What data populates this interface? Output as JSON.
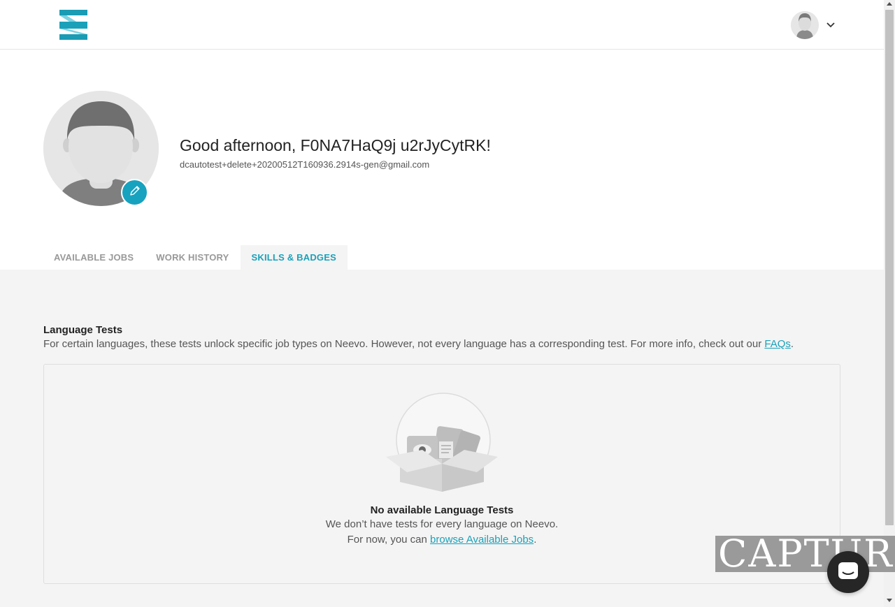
{
  "header": {
    "logo_name": "neevo-logo",
    "account_menu_icon": "chevron-down-icon"
  },
  "profile": {
    "greeting": "Good afternoon, F0NA7HaQ9j u2rJyCytRK!",
    "email": "dcautotest+delete+20200512T160936.2914s-gen@gmail.com",
    "edit_icon": "pencil-icon"
  },
  "tabs": [
    {
      "label": "AVAILABLE JOBS",
      "active": false
    },
    {
      "label": "WORK HISTORY",
      "active": false
    },
    {
      "label": "SKILLS & BADGES",
      "active": true
    }
  ],
  "language_tests": {
    "title": "Language Tests",
    "description_prefix": "For certain languages, these tests unlock specific job types on Neevo. However, not every language has a corresponding test. For more info, check out our ",
    "faq_link": "FAQs",
    "description_suffix": ".",
    "empty_title": "No available Language Tests",
    "empty_line1": "We don’t have tests for every language on Neevo.",
    "empty_line2_prefix": "For now, you can ",
    "empty_link": "browse Available Jobs",
    "empty_line2_suffix": "."
  },
  "overlay": {
    "watermark": "CAPTURE",
    "chat_icon": "chat-icon"
  },
  "colors": {
    "accent": "#17a2bf",
    "content_bg": "#f4f4f4"
  }
}
